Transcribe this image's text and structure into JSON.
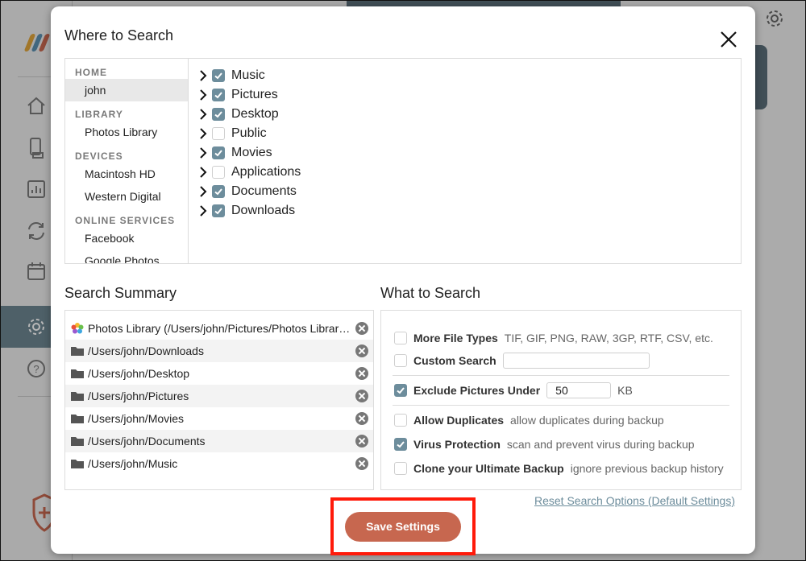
{
  "modal": {
    "title": "Where to Search",
    "close_icon": "close-icon"
  },
  "locations": {
    "groups": [
      {
        "header": "HOME",
        "items": [
          "john"
        ]
      },
      {
        "header": "LIBRARY",
        "items": [
          "Photos Library"
        ]
      },
      {
        "header": "DEVICES",
        "items": [
          "Macintosh HD",
          "Western Digital"
        ]
      },
      {
        "header": "ONLINE SERVICES",
        "items": [
          "Facebook",
          "Google Photos"
        ]
      }
    ],
    "selected": "john"
  },
  "folders": [
    {
      "label": "Music",
      "checked": true
    },
    {
      "label": "Pictures",
      "checked": true
    },
    {
      "label": "Desktop",
      "checked": true
    },
    {
      "label": "Public",
      "checked": false
    },
    {
      "label": "Movies",
      "checked": true
    },
    {
      "label": "Applications",
      "checked": false
    },
    {
      "label": "Documents",
      "checked": true
    },
    {
      "label": "Downloads",
      "checked": true
    }
  ],
  "summary": {
    "title": "Search Summary",
    "rows": [
      {
        "icon": "photos-icon",
        "text": "Photos Library (/Users/john/Pictures/Photos Library.photoslibrary)"
      },
      {
        "icon": "folder-icon",
        "text": "/Users/john/Downloads"
      },
      {
        "icon": "folder-icon",
        "text": "/Users/john/Desktop"
      },
      {
        "icon": "folder-icon",
        "text": "/Users/john/Pictures"
      },
      {
        "icon": "folder-icon",
        "text": "/Users/john/Movies"
      },
      {
        "icon": "folder-icon",
        "text": "/Users/john/Documents"
      },
      {
        "icon": "folder-icon",
        "text": "/Users/john/Music"
      }
    ]
  },
  "what": {
    "title": "What to Search",
    "options": {
      "more_file_types": {
        "label": "More File Types",
        "desc": "TIF, GIF, PNG, RAW, 3GP, RTF, CSV, etc.",
        "checked": false
      },
      "custom_search": {
        "label": "Custom Search",
        "value": "",
        "checked": false
      },
      "exclude_pictures": {
        "label": "Exclude Pictures Under",
        "value": "50",
        "unit": "KB",
        "checked": true
      },
      "allow_duplicates": {
        "label": "Allow Duplicates",
        "desc": "allow duplicates during backup",
        "checked": false
      },
      "virus_protection": {
        "label": "Virus Protection",
        "desc": "scan and prevent virus during backup",
        "checked": true
      },
      "clone_backup": {
        "label": "Clone your Ultimate Backup",
        "desc": "ignore previous backup history",
        "checked": false
      }
    }
  },
  "reset_link": "Reset Search Options (Default Settings)",
  "save_button": "Save Settings",
  "colors": {
    "accent": "#6d8d9c",
    "save": "#c7674f",
    "highlight": "#ff1a0a"
  }
}
